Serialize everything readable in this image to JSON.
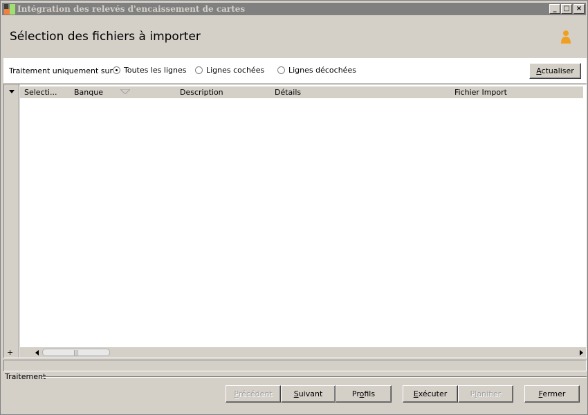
{
  "window": {
    "title": "Intégration des relevés d'encaissement de cartes",
    "controls": [
      "_",
      "□",
      "×"
    ]
  },
  "header": {
    "title": "Sélection des fichiers à importer"
  },
  "options": {
    "label": "Traitement uniquement sur :",
    "radios": [
      {
        "label": "Toutes les lignes",
        "checked": true
      },
      {
        "label": "Lignes cochées",
        "checked": false
      },
      {
        "label": "Lignes décochées",
        "checked": false
      }
    ],
    "refresh": {
      "pre": "",
      "key": "A",
      "post": "ctualiser"
    }
  },
  "grid": {
    "columns": [
      "Selecti...",
      "Banque",
      "Description",
      "Détails",
      "Fichier Import"
    ],
    "rows": [],
    "expand_symbol": "+",
    "thumb_grip": "|||"
  },
  "status": {
    "text": ""
  },
  "footer": {
    "group_label": "Traitement",
    "buttons": [
      {
        "pre": "",
        "key": "P",
        "post": "récédent",
        "enabled": false
      },
      {
        "pre": "",
        "key": "S",
        "post": "uivant",
        "enabled": true
      },
      {
        "pre": "Pr",
        "key": "o",
        "post": "fils",
        "enabled": true
      },
      {
        "pre": "",
        "key": "E",
        "post": "xécuter",
        "enabled": true
      },
      {
        "pre": "P",
        "key": "l",
        "post": "anifier",
        "enabled": false
      },
      {
        "pre": "",
        "key": "F",
        "post": "ermer",
        "enabled": true
      }
    ]
  }
}
